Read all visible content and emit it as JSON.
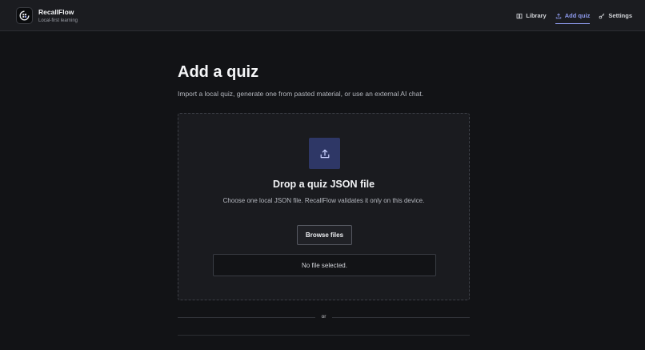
{
  "app": {
    "name": "RecallFlow",
    "tagline": "Local-first learning"
  },
  "nav": {
    "items": [
      {
        "label": "Library",
        "icon": "book-icon",
        "active": false
      },
      {
        "label": "Add quiz",
        "icon": "upload-icon",
        "active": true
      },
      {
        "label": "Settings",
        "icon": "key-icon",
        "active": false
      }
    ]
  },
  "page": {
    "title": "Add a quiz",
    "subtitle": "Import a local quiz, generate one from pasted material, or use an external AI chat."
  },
  "dropzone": {
    "icon": "upload-icon",
    "title": "Drop a quiz JSON file",
    "description": "Choose one local JSON file. RecallFlow validates it only on this device.",
    "browse_label": "Browse files",
    "file_status": "No file selected."
  },
  "divider": {
    "label": "or"
  },
  "colors": {
    "background": "#121316",
    "header": "#1b1c20",
    "accent": "#8f9cf0",
    "upload_tile": "#2e3766"
  }
}
